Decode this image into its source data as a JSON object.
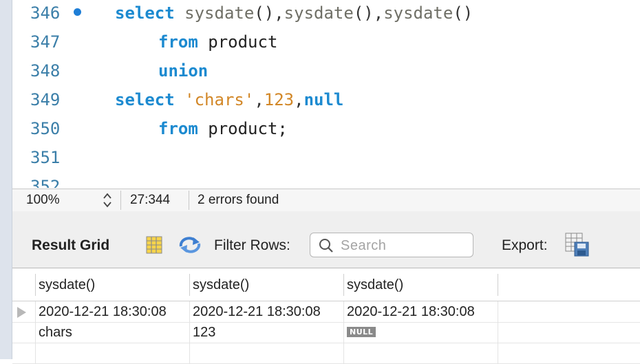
{
  "editor": {
    "lines": [
      {
        "n": "346",
        "tokens": [
          {
            "t": "select",
            "c": "kw"
          },
          {
            "t": " ",
            "c": "id"
          },
          {
            "t": "sysdate",
            "c": "fn"
          },
          {
            "t": "(),",
            "c": "punc"
          },
          {
            "t": "sysdate",
            "c": "fn"
          },
          {
            "t": "(),",
            "c": "punc"
          },
          {
            "t": "sysdate",
            "c": "fn"
          },
          {
            "t": "()",
            "c": "punc"
          }
        ],
        "indent": 2,
        "marker": true
      },
      {
        "n": "347",
        "tokens": [
          {
            "t": "from",
            "c": "kw"
          },
          {
            "t": " product",
            "c": "id"
          }
        ],
        "indent": 3,
        "marker": false
      },
      {
        "n": "348",
        "tokens": [
          {
            "t": "union",
            "c": "kw"
          }
        ],
        "indent": 3,
        "marker": false
      },
      {
        "n": "349",
        "tokens": [
          {
            "t": "select",
            "c": "kw"
          },
          {
            "t": " ",
            "c": "id"
          },
          {
            "t": "'chars'",
            "c": "str"
          },
          {
            "t": ",",
            "c": "punc"
          },
          {
            "t": "123",
            "c": "num"
          },
          {
            "t": ",",
            "c": "punc"
          },
          {
            "t": "null",
            "c": "kw"
          }
        ],
        "indent": 2,
        "marker": false
      },
      {
        "n": "350",
        "tokens": [
          {
            "t": "from",
            "c": "kw"
          },
          {
            "t": " product;",
            "c": "id"
          }
        ],
        "indent": 3,
        "marker": false
      },
      {
        "n": "351",
        "tokens": [],
        "indent": 0,
        "marker": false
      },
      {
        "n": "352",
        "tokens": [],
        "indent": 0,
        "marker": false
      }
    ]
  },
  "status": {
    "zoom": "100%",
    "cursor": "27:344",
    "errors": "2 errors found"
  },
  "toolbar": {
    "result_grid": "Result Grid",
    "filter_label": "Filter Rows:",
    "search_placeholder": "Search",
    "export_label": "Export:"
  },
  "grid": {
    "columns": [
      "sysdate()",
      "sysdate()",
      "sysdate()"
    ],
    "rows": [
      [
        "2020-12-21 18:30:08",
        "2020-12-21 18:30:08",
        "2020-12-21 18:30:08"
      ],
      [
        "chars",
        "123",
        "NULL"
      ]
    ],
    "null_text": "NULL"
  },
  "colors": {
    "keyword": "#1c8ad0",
    "function": "#6f6f66",
    "string": "#d28727",
    "line_number": "#3a7ea8"
  }
}
